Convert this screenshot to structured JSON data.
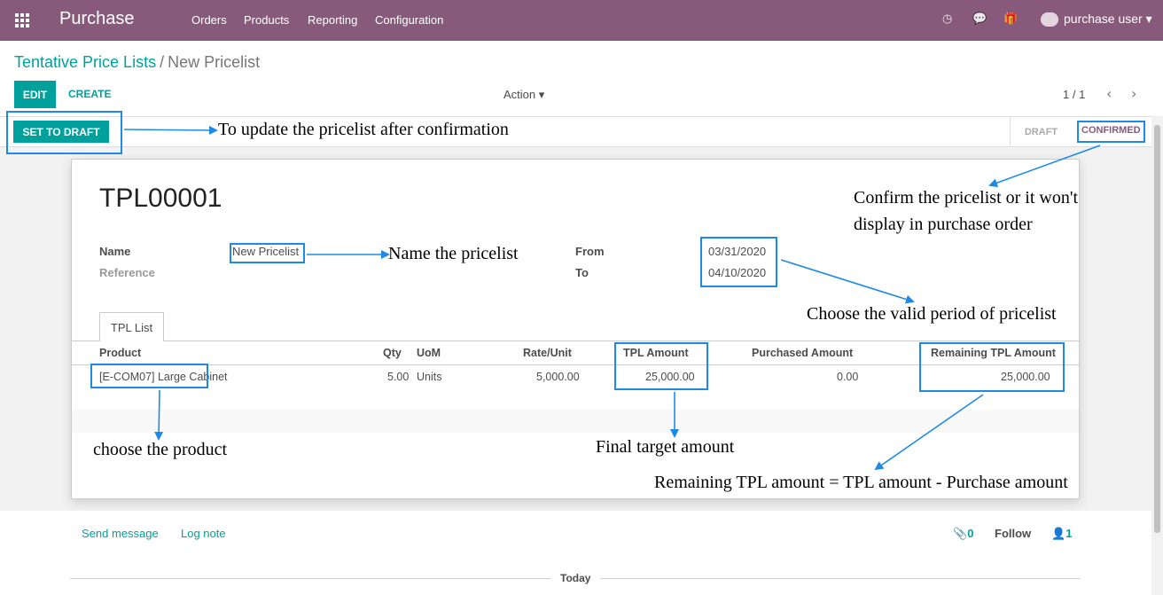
{
  "navbar": {
    "brand": "Purchase",
    "menu": [
      "Orders",
      "Products",
      "Reporting",
      "Configuration"
    ],
    "user": "purchase user",
    "icons": [
      "apps-icon",
      "clock-icon",
      "chat-icon",
      "gift-icon",
      "avatar-icon"
    ]
  },
  "breadcrumb": {
    "parent": "Tentative Price Lists",
    "separator": "/",
    "current": "New Pricelist"
  },
  "controls": {
    "edit": "EDIT",
    "create": "CREATE",
    "action": "Action",
    "pager": "1 / 1"
  },
  "statusbar": {
    "set_to_draft": "SET TO DRAFT",
    "stages": [
      "DRAFT",
      "CONFIRMED"
    ],
    "active_stage": "CONFIRMED"
  },
  "record": {
    "number": "TPL00001",
    "name_label": "Name",
    "name_value": "New Pricelist",
    "reference_label": "Reference",
    "from_label": "From",
    "from_value": "03/31/2020",
    "to_label": "To",
    "to_value": "04/10/2020"
  },
  "tab": "TPL List",
  "table": {
    "columns": [
      "Product",
      "Qty",
      "UoM",
      "Rate/Unit",
      "TPL Amount",
      "Purchased Amount",
      "Remaining TPL Amount"
    ],
    "rows": [
      [
        "[E-COM07] Large Cabinet",
        "5.00",
        "Units",
        "5,000.00",
        "25,000.00",
        "0.00",
        "25,000.00"
      ]
    ]
  },
  "annotations": {
    "draft": "To update the pricelist after confirmation",
    "confirm_1": "Confirm the pricelist or it won't",
    "confirm_2": "display in purchase order",
    "name": "Name the pricelist",
    "period": "Choose the valid period of pricelist",
    "product": "choose the product",
    "target": "Final target amount",
    "remaining": "Remaining TPL amount = TPL amount - Purchase amount"
  },
  "chatter": {
    "send_message": "Send message",
    "log_note": "Log note",
    "attachments": "0",
    "follow": "Follow",
    "followers": "1",
    "today": "Today"
  },
  "colors": {
    "brand": "#875a7b",
    "primary": "#00A09D",
    "annotation": "#1e8ae6"
  }
}
